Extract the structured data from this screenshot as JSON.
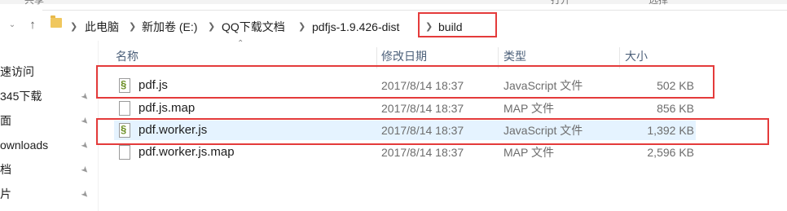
{
  "topstrip": {
    "left": "共享",
    "mid": "打开",
    "right": "选择"
  },
  "breadcrumb": {
    "items": [
      "此电脑",
      "新加卷 (E:)",
      "QQ下载文档",
      "pdfjs-1.9.426-dist",
      "build"
    ]
  },
  "nav": {
    "items": [
      {
        "label": "速访问",
        "pinned": false
      },
      {
        "label": "345下载",
        "pinned": true
      },
      {
        "label": "面",
        "pinned": true
      },
      {
        "label": "ownloads",
        "pinned": true
      },
      {
        "label": "档",
        "pinned": true
      },
      {
        "label": "片",
        "pinned": true
      }
    ]
  },
  "columns": {
    "name": "名称",
    "date": "修改日期",
    "type": "类型",
    "size": "大小"
  },
  "files": [
    {
      "name": "pdf.js",
      "date": "2017/8/14 18:37",
      "type": "JavaScript 文件",
      "size": "502 KB",
      "icon": "js-file-icon"
    },
    {
      "name": "pdf.js.map",
      "date": "2017/8/14 18:37",
      "type": "MAP 文件",
      "size": "856 KB",
      "icon": "file-icon"
    },
    {
      "name": "pdf.worker.js",
      "date": "2017/8/14 18:37",
      "type": "JavaScript 文件",
      "size": "1,392 KB",
      "icon": "js-file-icon"
    },
    {
      "name": "pdf.worker.js.map",
      "date": "2017/8/14 18:37",
      "type": "MAP 文件",
      "size": "2,596 KB",
      "icon": "file-icon"
    }
  ],
  "colors": {
    "highlight": "#e43b3b",
    "selected_row": "#e5f3ff",
    "header_text": "#4c607a"
  }
}
